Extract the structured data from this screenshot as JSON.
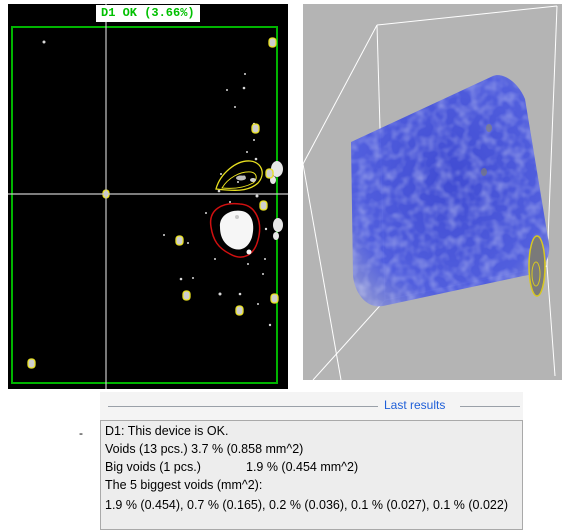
{
  "xray_view": {
    "status_label": "D1 OK  (3.66%)",
    "status_color": "#00c000",
    "frame_color": "#00b400",
    "void_outline_color": "#e8e020",
    "big_void_outline_color": "#d01010",
    "crosshair_color": "#c8c8c8"
  },
  "volume_view": {
    "background_color": "#b4b4b4",
    "volume_color": "#4050d8",
    "box_edge_color": "#ffffff"
  },
  "results": {
    "title": "Last results",
    "title_color": "#1f5fd8",
    "lines": [
      "D1: This device is OK.",
      "Voids (13 pcs.)   3.7 % (0.858 mm^2)",
      "Big voids (1 pcs.)",
      "1.9 % (0.454 mm^2)",
      "The 5 biggest voids (mm^2):",
      "1.9 % (0.454), 0.7 % (0.165), 0.2 % (0.036), 0.1 % (0.027), 0.1 % (0.022)"
    ]
  },
  "side_mark": "-"
}
